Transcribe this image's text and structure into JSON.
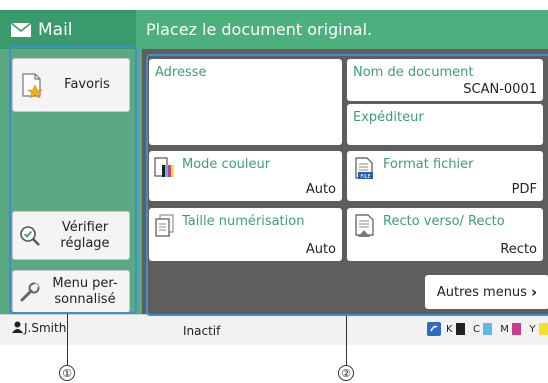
{
  "header": {
    "app_title": "Mail",
    "message": "Placez le document original."
  },
  "sidebar": {
    "favorites_label": "Favoris",
    "check_settings_label": "Vérifier réglage",
    "custom_menu_label": "Menu per-sonnalisé"
  },
  "main": {
    "address_label": "Adresse",
    "document_name_label": "Nom de document",
    "document_name_value": "SCAN-0001",
    "sender_label": "Expéditeur",
    "color_mode_label": "Mode couleur",
    "color_mode_value": "Auto",
    "file_format_label": "Format fichier",
    "file_format_value": "PDF",
    "scan_size_label": "Taille numérisation",
    "scan_size_value": "Auto",
    "duplex_label": "Recto verso/ Recto",
    "duplex_value": "Recto",
    "other_menus_label": "Autres menus"
  },
  "status_bar": {
    "user": "J.Smith",
    "state": "Inactif",
    "ink": [
      {
        "letter": "K",
        "color": "#222222"
      },
      {
        "letter": "C",
        "color": "#5fb8e8"
      },
      {
        "letter": "M",
        "color": "#c2418a"
      },
      {
        "letter": "Y",
        "color": "#f0e030"
      }
    ]
  },
  "callouts": {
    "left": "①",
    "right": "②"
  },
  "colors": {
    "accent": "#4caf7d",
    "accent_dark": "#3a9a6b",
    "selection": "#3b8fd0",
    "tile_title": "#3d9f6e"
  }
}
